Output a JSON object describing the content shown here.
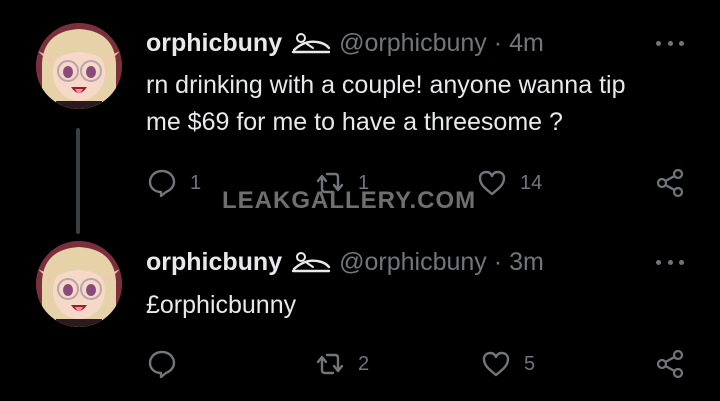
{
  "tweets": [
    {
      "display_name": "orphicbuny",
      "badge_icon": "reclining-figure-emoji",
      "handle": "@orphicbuny",
      "separator": "·",
      "time": "4m",
      "text_line1": "rn drinking with a couple! anyone wanna tip",
      "text_line2": "me $69 for me to have a threesome ?",
      "replies": "1",
      "retweets": "1",
      "likes": "14"
    },
    {
      "display_name": "orphicbuny",
      "badge_icon": "reclining-figure-emoji",
      "handle": "@orphicbuny",
      "separator": "·",
      "time": "3m",
      "text_line1": "£orphicbunny",
      "replies": "",
      "retweets": "2",
      "likes": "5"
    }
  ],
  "watermark": "LEAKGALLERY.COM",
  "colors": {
    "background": "#000000",
    "primary_text": "#e7e9ea",
    "secondary_text": "#71767b",
    "thread_line": "#3a3f44"
  }
}
